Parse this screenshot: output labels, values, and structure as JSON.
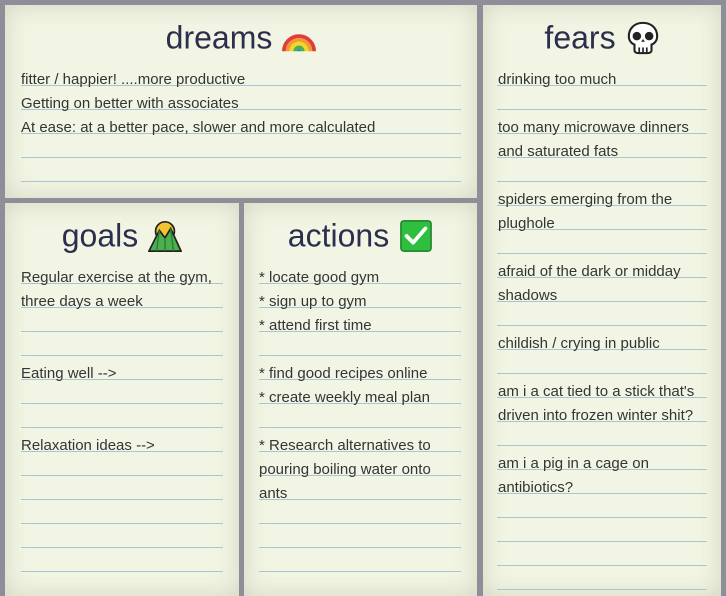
{
  "dreams": {
    "title": "dreams",
    "emoji": "rainbow-icon",
    "lines": [
      "fitter / happier! ....more productive",
      "Getting on better with associates",
      "At ease: at a better pace, slower and more calculated",
      "",
      ""
    ]
  },
  "fears": {
    "title": "fears",
    "emoji": "skull-icon",
    "lines": [
      "drinking too much",
      "",
      "too many microwave dinners",
      "and saturated fats",
      "",
      "spiders emerging from the",
      "plughole",
      "",
      "afraid of the dark or midday",
      "shadows",
      "",
      "childish / crying in public",
      "",
      "am i a cat tied to a stick that's",
      "driven into frozen winter shit?",
      "",
      "am i a pig in a cage on",
      "antibiotics?",
      "",
      "",
      "",
      ""
    ]
  },
  "goals": {
    "title": "goals",
    "emoji": "mountain-icon",
    "lines": [
      "Regular exercise at the gym,",
      "three days a week",
      "",
      "",
      "Eating well -->",
      "",
      "",
      "Relaxation ideas -->",
      "",
      "",
      "",
      "",
      ""
    ]
  },
  "actions": {
    "title": "actions",
    "emoji": "check-mark-icon",
    "lines": [
      "* locate good gym",
      "* sign up to gym",
      "* attend first time",
      "",
      "* find good recipes online",
      "* create weekly meal plan",
      "",
      "* Research alternatives to",
      "pouring boiling water onto",
      "ants",
      "",
      "",
      ""
    ]
  }
}
